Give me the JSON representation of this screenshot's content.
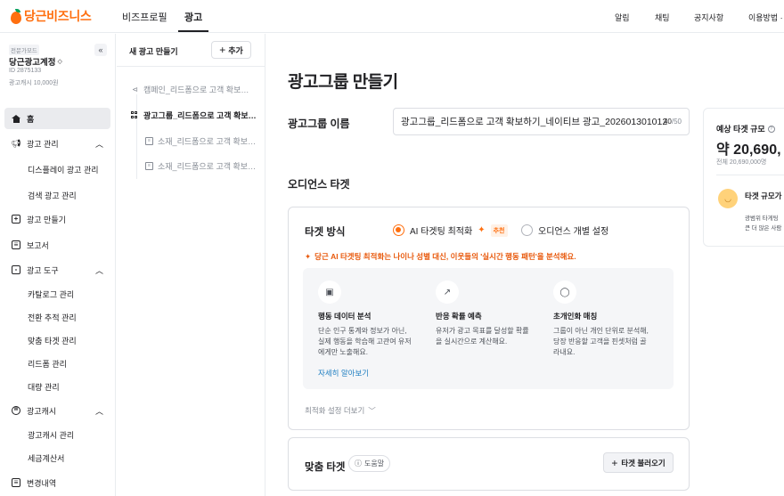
{
  "brand": {
    "logo_text": "당근비즈니스",
    "accent": "#ff6f0f",
    "leaf": "#00a05b"
  },
  "topnav": {
    "tabs": [
      "비즈프로필",
      "광고"
    ],
    "active_tab": "광고",
    "right": [
      "알림",
      "채팅",
      "공지사항",
      "이용방법 ·"
    ]
  },
  "sidebar": {
    "account": {
      "badge": "전문가모드",
      "name": "당근광고계정",
      "id": "ID 2875133",
      "cash": "광고캐시 10,000원"
    },
    "collapse_icon": "chevron-double-left-icon",
    "items": [
      {
        "label": "홈",
        "icon": "home-icon",
        "active": true
      },
      {
        "label": "광고 관리",
        "icon": "megaphone-icon",
        "expanded": true,
        "children": [
          "디스플레이 광고 관리",
          "검색 광고 관리"
        ]
      },
      {
        "label": "광고 만들기",
        "icon": "plus-square-icon"
      },
      {
        "label": "보고서",
        "icon": "report-icon"
      },
      {
        "label": "광고 도구",
        "icon": "briefcase-icon",
        "expanded": true,
        "children": [
          "카탈로그 관리",
          "전환 추적 관리",
          "맞춤 타겟 관리",
          "리드폼 관리",
          "대량 관리"
        ]
      },
      {
        "label": "광고캐시",
        "icon": "won-circle-icon",
        "expanded": true,
        "children": [
          "광고캐시 관리",
          "세금계산서"
        ]
      },
      {
        "label": "변경내역",
        "icon": "history-icon"
      }
    ]
  },
  "midpanel": {
    "title": "새 광고 만들기",
    "add_label": "추가",
    "tree": [
      {
        "label": "캠페인_리드폼으로 고객 확보…",
        "icon": "megaphone-icon",
        "active": false
      },
      {
        "label": "광고그룹_리드폼으로 고객 확보…",
        "icon": "grid-icon",
        "active": true
      },
      {
        "label": "소재_리드폼으로 고객 확보…",
        "icon": "document-icon",
        "active": false
      },
      {
        "label": "소재_리드폼으로 고객 확보…",
        "icon": "document-icon",
        "active": false
      }
    ]
  },
  "main": {
    "title": "광고그룹 만들기",
    "name_label": "광고그룹 이름",
    "name_value": "광고그룹_리드폼으로 고객 확보하기_네이티브 광고_202601301012",
    "name_count": "40",
    "name_max": "/50",
    "audience_title": "오디언스 타겟",
    "targeting": {
      "label": "타겟 방식",
      "options": [
        {
          "label": "AI 타겟팅 최적화",
          "selected": true,
          "badge": "추천"
        },
        {
          "label": "오디언스 개별 설정",
          "selected": false
        }
      ],
      "notice": "당근 AI 타겟팅 최적화는 나이나 성별 대신, 이웃들의 '실시간 행동 패턴'을 분석해요.",
      "features": [
        {
          "icon": "chat-bubble-icon",
          "title": "행동 데이터 분석",
          "desc": [
            "단순 인구 통계와 정보가 아닌,",
            "실제 행동을 학습해 고관여 유저",
            "에게만 노출해요."
          ]
        },
        {
          "icon": "trend-up-icon",
          "title": "반응 확률 예측",
          "desc": [
            "유저가 광고 목표를 달성할 확률",
            "을 실시간으로 계산해요."
          ]
        },
        {
          "icon": "person-icon",
          "title": "초개인화 매칭",
          "desc": [
            "그룹이 아닌 개인 단위로 분석해,",
            "당장 반응할 고객을 핀셋처럼 골",
            "라내요."
          ]
        }
      ],
      "learn_more": "자세히 알아보기",
      "more_options": "최적화 설정 더보기"
    },
    "custom_target": {
      "label": "맞춤 타겟",
      "help": "도움말",
      "load": "타겟 불러오기"
    }
  },
  "estimate": {
    "label": "예상 타겟 규모",
    "value": "약 20,690,",
    "total": "전체 20,690,000명",
    "size_label": "타겟 규모가",
    "desc": [
      "광범위 타게팅",
      "큰 더 많은 사람"
    ]
  }
}
